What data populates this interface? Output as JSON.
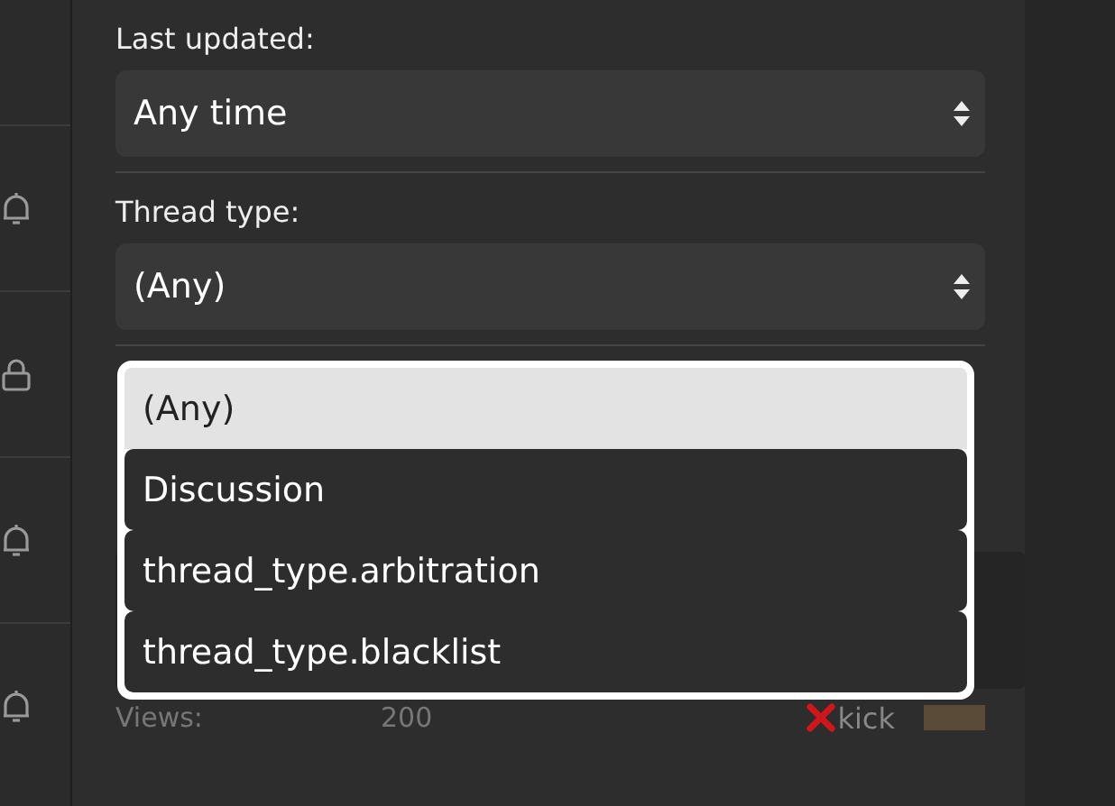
{
  "filters": [
    {
      "label": "Last updated:",
      "value": "Any time"
    },
    {
      "label": "Thread type:",
      "value": "(Any)"
    }
  ],
  "dropdown": {
    "options": [
      {
        "label": "(Any)",
        "selected": true
      },
      {
        "label": "Discussion",
        "selected": false
      },
      {
        "label": "thread_type.arbitration",
        "selected": false
      },
      {
        "label": "thread_type.blacklist",
        "selected": false
      }
    ]
  },
  "background": {
    "views_label": "Views:",
    "views_value": "200",
    "action": "kick"
  }
}
